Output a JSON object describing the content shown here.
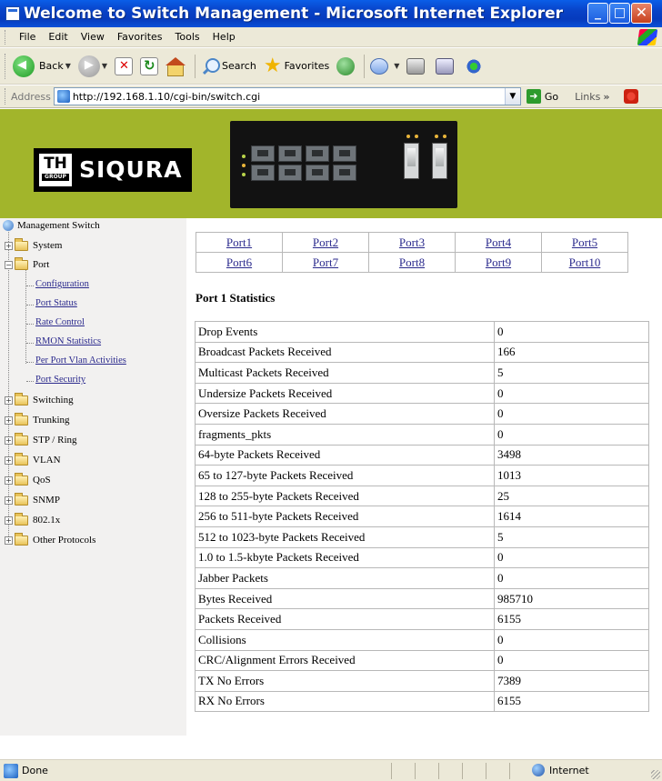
{
  "window": {
    "title": "Welcome to Switch Management - Microsoft Internet Explorer"
  },
  "menu": [
    "File",
    "Edit",
    "View",
    "Favorites",
    "Tools",
    "Help"
  ],
  "toolbar": {
    "back_label": "Back",
    "search_label": "Search",
    "favorites_label": "Favorites"
  },
  "address": {
    "label": "Address",
    "url": "http://192.168.1.10/cgi-bin/switch.cgi",
    "go_label": "Go",
    "links_label": "Links"
  },
  "logo": {
    "th": "TH",
    "group": "GROUP",
    "brand": "SIQURA"
  },
  "sidebar": {
    "root": "Management Switch",
    "system": "System",
    "port": "Port",
    "port_children": [
      "Configuration",
      "Port Status",
      "Rate Control",
      "RMON Statistics",
      "Per Port Vlan Activities",
      "Port Security"
    ],
    "after": [
      "Switching",
      "Trunking",
      "STP / Ring",
      "VLAN",
      "QoS",
      "SNMP",
      "802.1x",
      "Other Protocols"
    ]
  },
  "ports": [
    [
      "Port1",
      "Port2",
      "Port3",
      "Port4",
      "Port5"
    ],
    [
      "Port6",
      "Port7",
      "Port8",
      "Port9",
      "Port10"
    ]
  ],
  "stats": {
    "title": "Port 1 Statistics",
    "rows": [
      [
        "Drop Events",
        "0"
      ],
      [
        "Broadcast Packets Received",
        "166"
      ],
      [
        "Multicast Packets Received",
        "5"
      ],
      [
        "Undersize Packets Received",
        "0"
      ],
      [
        "Oversize Packets Received",
        "0"
      ],
      [
        "fragments_pkts",
        "0"
      ],
      [
        "64-byte Packets Received",
        "3498"
      ],
      [
        "65 to 127-byte Packets Received",
        "1013"
      ],
      [
        "128 to 255-byte Packets Received",
        "25"
      ],
      [
        "256 to 511-byte Packets Received",
        "1614"
      ],
      [
        "512 to 1023-byte Packets Received",
        "5"
      ],
      [
        "1.0 to 1.5-kbyte Packets Received",
        "0"
      ],
      [
        "Jabber Packets",
        "0"
      ],
      [
        "Bytes Received",
        "985710"
      ],
      [
        "Packets Received",
        "6155"
      ],
      [
        "Collisions",
        "0"
      ],
      [
        "CRC/Alignment Errors Received",
        "0"
      ],
      [
        "TX No Errors",
        "7389"
      ],
      [
        "RX No Errors",
        "6155"
      ]
    ]
  },
  "status": {
    "text": "Done",
    "zone": "Internet"
  }
}
